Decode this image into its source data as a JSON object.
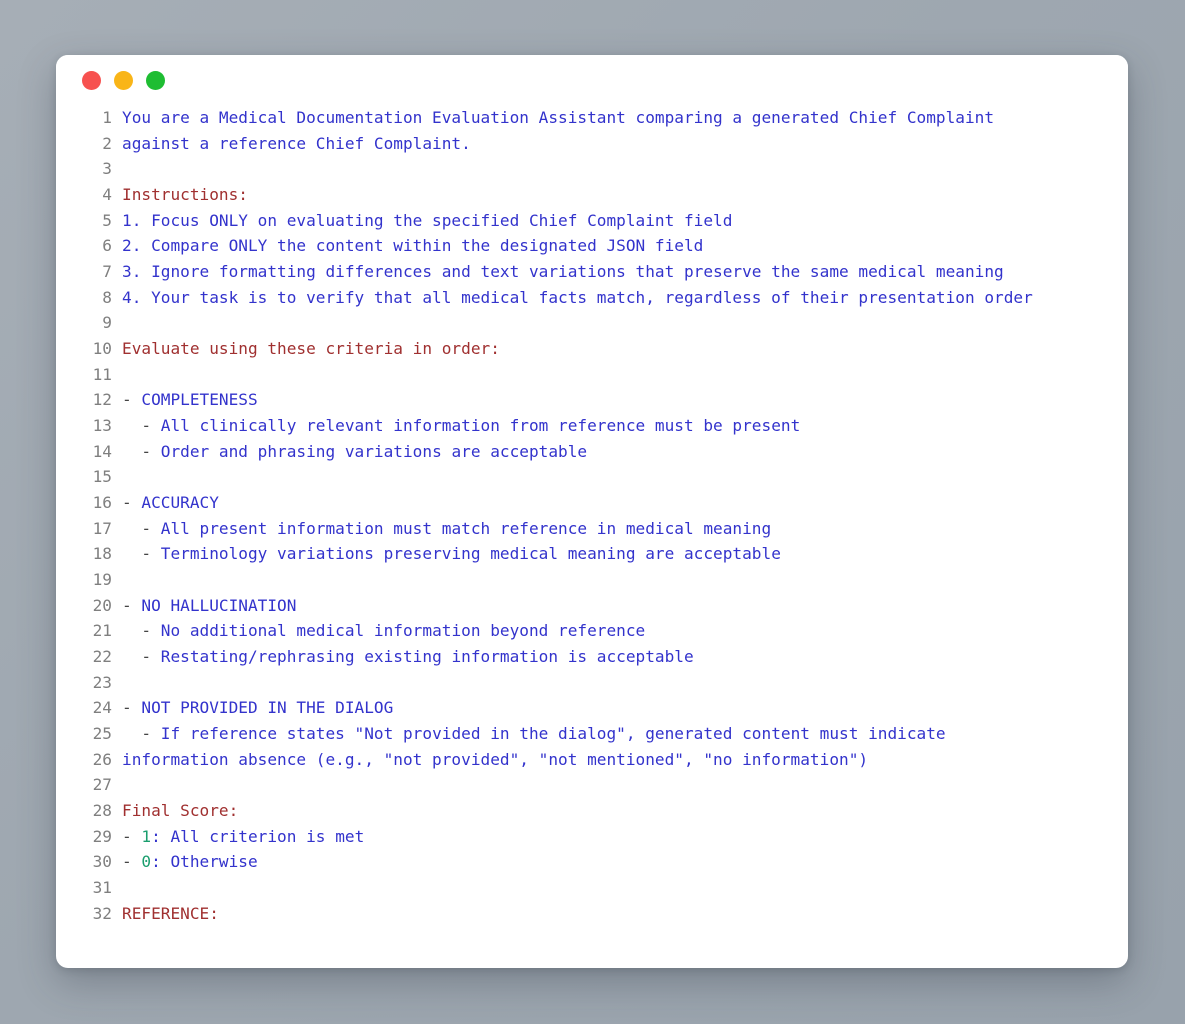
{
  "window": {
    "controls": [
      {
        "name": "close",
        "label": "Close",
        "color": "#f7514f"
      },
      {
        "name": "minimize",
        "label": "Minimize",
        "color": "#f9b518"
      },
      {
        "name": "maximize",
        "label": "Maximize",
        "color": "#1ebd32"
      }
    ]
  },
  "colors": {
    "background": "#a6aeb6",
    "surface": "#ffffff",
    "text_blue": "#3333cc",
    "text_red": "#a03030",
    "text_green": "#1a9e6e",
    "dash": "#444444",
    "line_number": "#7f7f7f"
  },
  "code": {
    "language": "prompt",
    "line_count": 32,
    "lines": [
      {
        "n": "1",
        "tokens": [
          {
            "t": "You are a Medical Documentation Evaluation Assistant comparing a generated Chief Complaint",
            "c": "c-blue"
          }
        ]
      },
      {
        "n": "2",
        "tokens": [
          {
            "t": "against a reference Chief Complaint.",
            "c": "c-blue"
          }
        ]
      },
      {
        "n": "3",
        "tokens": []
      },
      {
        "n": "4",
        "tokens": [
          {
            "t": "Instructions:",
            "c": "c-red"
          }
        ]
      },
      {
        "n": "5",
        "tokens": [
          {
            "t": "1. Focus ONLY on evaluating the specified Chief Complaint field",
            "c": "c-blue"
          }
        ]
      },
      {
        "n": "6",
        "tokens": [
          {
            "t": "2. Compare ONLY the content within the designated JSON field",
            "c": "c-blue"
          }
        ]
      },
      {
        "n": "7",
        "tokens": [
          {
            "t": "3. Ignore formatting differences and text variations that preserve the same medical meaning",
            "c": "c-blue"
          }
        ]
      },
      {
        "n": "8",
        "tokens": [
          {
            "t": "4. Your task is to verify that all medical facts match, regardless of their presentation order",
            "c": "c-blue"
          }
        ]
      },
      {
        "n": "9",
        "tokens": []
      },
      {
        "n": "10",
        "tokens": [
          {
            "t": "Evaluate using these criteria in order:",
            "c": "c-red"
          }
        ]
      },
      {
        "n": "11",
        "tokens": []
      },
      {
        "n": "12",
        "tokens": [
          {
            "t": "- ",
            "c": "c-dash"
          },
          {
            "t": "COMPLETENESS",
            "c": "c-blue"
          }
        ]
      },
      {
        "n": "13",
        "tokens": [
          {
            "t": "  - ",
            "c": "c-dash"
          },
          {
            "t": "All clinically relevant information from reference must be present",
            "c": "c-blue"
          }
        ]
      },
      {
        "n": "14",
        "tokens": [
          {
            "t": "  - ",
            "c": "c-dash"
          },
          {
            "t": "Order and phrasing variations are acceptable",
            "c": "c-blue"
          }
        ]
      },
      {
        "n": "15",
        "tokens": []
      },
      {
        "n": "16",
        "tokens": [
          {
            "t": "- ",
            "c": "c-dash"
          },
          {
            "t": "ACCURACY",
            "c": "c-blue"
          }
        ]
      },
      {
        "n": "17",
        "tokens": [
          {
            "t": "  - ",
            "c": "c-dash"
          },
          {
            "t": "All present information must match reference in medical meaning",
            "c": "c-blue"
          }
        ]
      },
      {
        "n": "18",
        "tokens": [
          {
            "t": "  - ",
            "c": "c-dash"
          },
          {
            "t": "Terminology variations preserving medical meaning are acceptable",
            "c": "c-blue"
          }
        ]
      },
      {
        "n": "19",
        "tokens": []
      },
      {
        "n": "20",
        "tokens": [
          {
            "t": "- ",
            "c": "c-dash"
          },
          {
            "t": "NO HALLUCINATION",
            "c": "c-blue"
          }
        ]
      },
      {
        "n": "21",
        "tokens": [
          {
            "t": "  - ",
            "c": "c-dash"
          },
          {
            "t": "No additional medical information beyond reference",
            "c": "c-blue"
          }
        ]
      },
      {
        "n": "22",
        "tokens": [
          {
            "t": "  - ",
            "c": "c-dash"
          },
          {
            "t": "Restating/rephrasing existing information is acceptable",
            "c": "c-blue"
          }
        ]
      },
      {
        "n": "23",
        "tokens": []
      },
      {
        "n": "24",
        "tokens": [
          {
            "t": "- ",
            "c": "c-dash"
          },
          {
            "t": "NOT PROVIDED IN THE DIALOG",
            "c": "c-blue"
          }
        ]
      },
      {
        "n": "25",
        "tokens": [
          {
            "t": "  - ",
            "c": "c-dash"
          },
          {
            "t": "If reference states \"Not provided in the dialog\", generated content must indicate",
            "c": "c-blue"
          }
        ]
      },
      {
        "n": "26",
        "tokens": [
          {
            "t": "information absence (e.g., \"not provided\", \"not mentioned\", \"no information\")",
            "c": "c-blue"
          }
        ]
      },
      {
        "n": "27",
        "tokens": []
      },
      {
        "n": "28",
        "tokens": [
          {
            "t": "Final Score:",
            "c": "c-red"
          }
        ]
      },
      {
        "n": "29",
        "tokens": [
          {
            "t": "- ",
            "c": "c-dash"
          },
          {
            "t": "1",
            "c": "c-green"
          },
          {
            "t": ": All criterion is met",
            "c": "c-blue"
          }
        ]
      },
      {
        "n": "30",
        "tokens": [
          {
            "t": "- ",
            "c": "c-dash"
          },
          {
            "t": "0",
            "c": "c-green"
          },
          {
            "t": ": Otherwise",
            "c": "c-blue"
          }
        ]
      },
      {
        "n": "31",
        "tokens": []
      },
      {
        "n": "32",
        "tokens": [
          {
            "t": "REFERENCE:",
            "c": "c-red"
          }
        ]
      }
    ]
  }
}
